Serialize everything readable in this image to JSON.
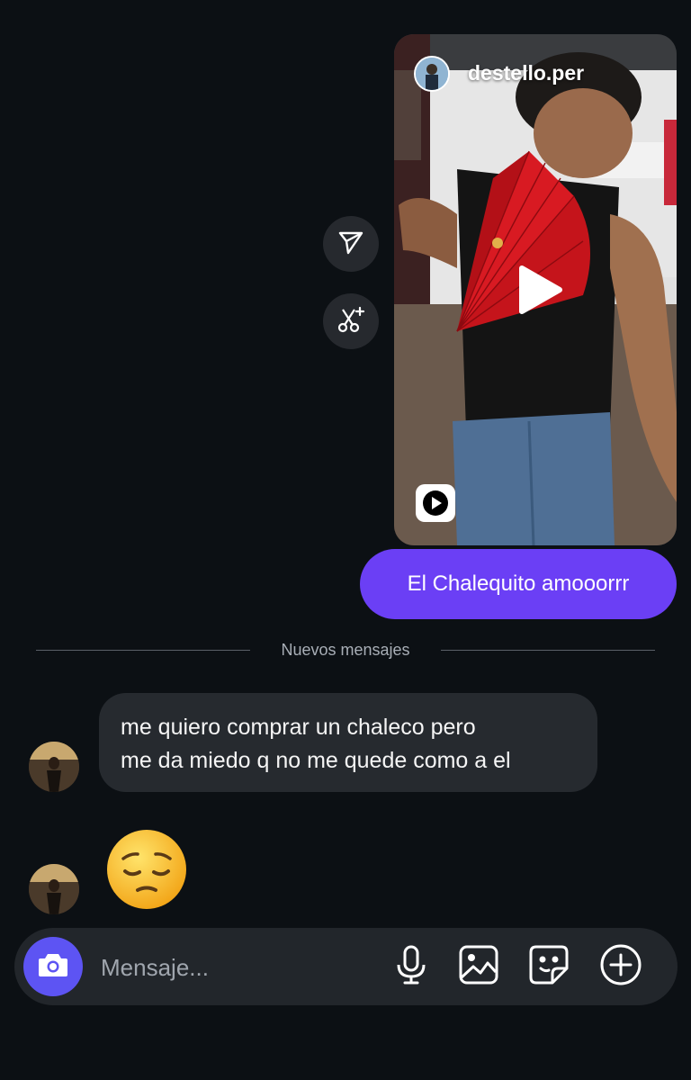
{
  "shared_reel": {
    "username": "destello.per"
  },
  "messages": {
    "outgoing_text": "El Chalequito amooorrr",
    "divider_label": "Nuevos mensajes",
    "incoming_line1": "me quiero comprar un chaleco pero",
    "incoming_line2": "me da miedo q no me quede como a el",
    "incoming_emoji": "pensive-face-emoji"
  },
  "composer": {
    "placeholder": "Mensaje..."
  },
  "icons": {
    "share": "send-icon",
    "remix": "scissors-sparkle-icon",
    "camera": "camera-icon",
    "mic": "microphone-icon",
    "gallery": "image-icon",
    "sticker": "sticker-icon",
    "add": "plus-circle-icon"
  },
  "colors": {
    "background": "#0c1014",
    "outgoing_bubble": "#6b3ff5",
    "incoming_bubble": "#262a2f",
    "camera_button": "#5d54f3"
  }
}
